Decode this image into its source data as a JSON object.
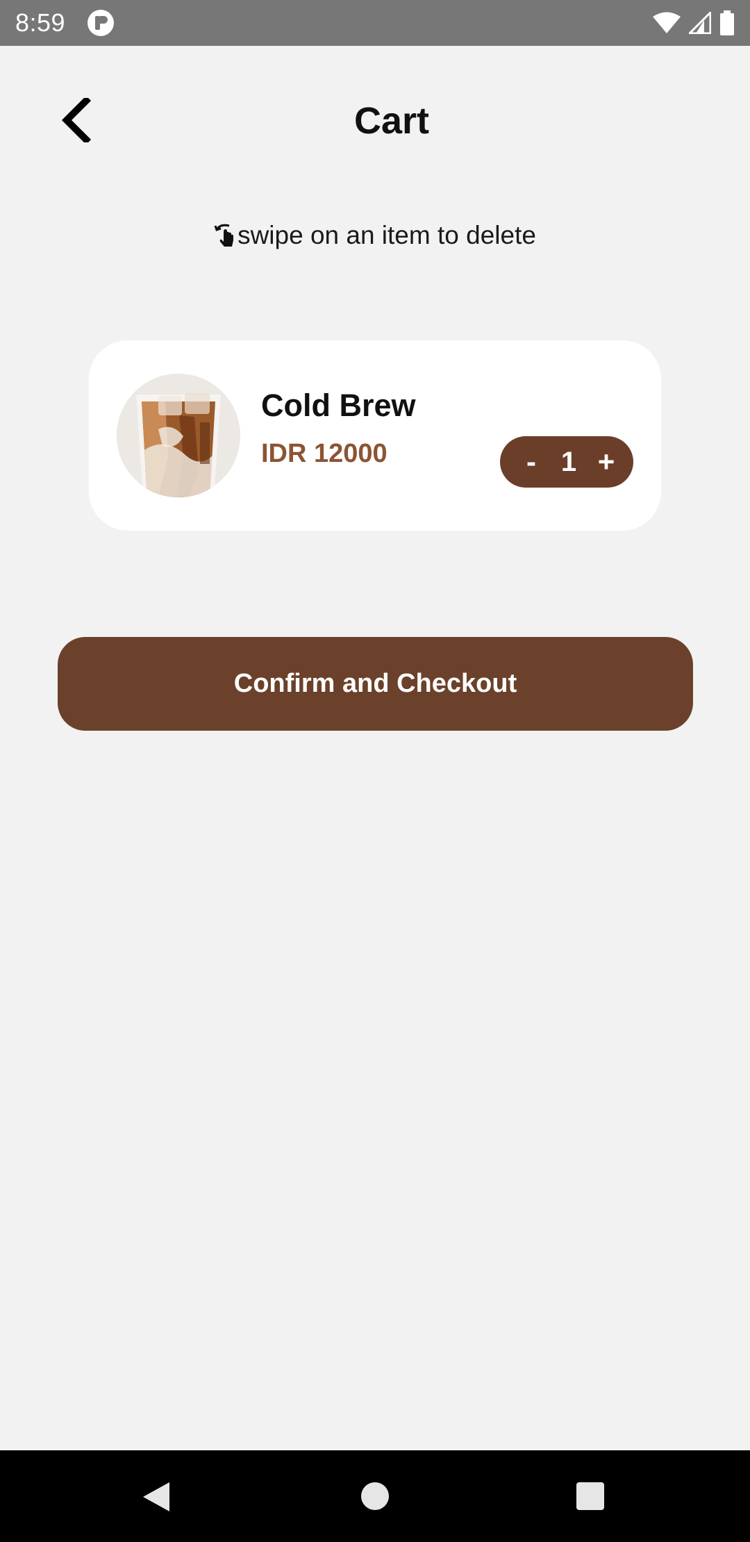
{
  "status_bar": {
    "time": "8:59"
  },
  "header": {
    "title": "Cart"
  },
  "hint": {
    "text": "swipe on an item to delete",
    "icon": "swipe-hand-icon"
  },
  "cart": {
    "items": [
      {
        "name": "Cold Brew",
        "price": "IDR 12000",
        "quantity": "1",
        "minus_label": "-",
        "plus_label": "+"
      }
    ]
  },
  "checkout": {
    "label": "Confirm and Checkout"
  },
  "colors": {
    "background": "#f2f2f2",
    "accent_brown": "#6b412b",
    "price_brown": "#8c5434",
    "card": "#ffffff"
  }
}
